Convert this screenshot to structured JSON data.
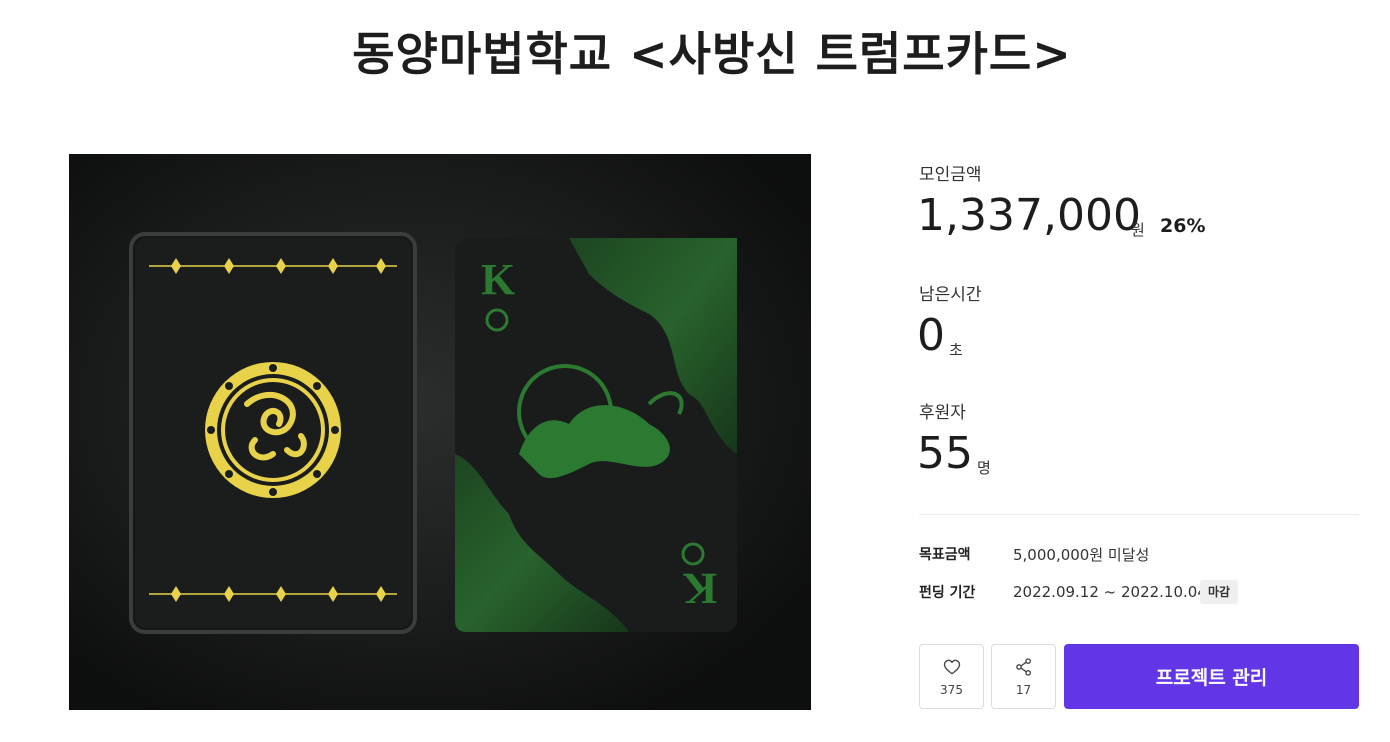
{
  "project": {
    "title": "동양마법학교 <사방신 트럼프카드>"
  },
  "hero_image": {
    "card_letter": "K",
    "colors": {
      "gold": "#e8d24a",
      "green": "#2a6a2e",
      "dark": "#151616"
    }
  },
  "stats": {
    "amount": {
      "label": "모인금액",
      "value": "1,337,000",
      "unit": "원",
      "percent": "26%"
    },
    "time": {
      "label": "남은시간",
      "value": "0",
      "unit": "초"
    },
    "backers": {
      "label": "후원자",
      "value": "55",
      "unit": "명"
    }
  },
  "info": {
    "goal": {
      "label": "목표금액",
      "value": "5,000,000원 미달성"
    },
    "period": {
      "label": "펀딩 기간",
      "value": "2022.09.12 ~ 2022.10.04",
      "badge": "마감"
    }
  },
  "actions": {
    "like": {
      "icon": "heart-icon",
      "count": "375"
    },
    "share": {
      "icon": "share-icon",
      "count": "17"
    },
    "manage": {
      "label": "프로젝트 관리"
    }
  },
  "colors": {
    "accent": "#6236e6"
  }
}
